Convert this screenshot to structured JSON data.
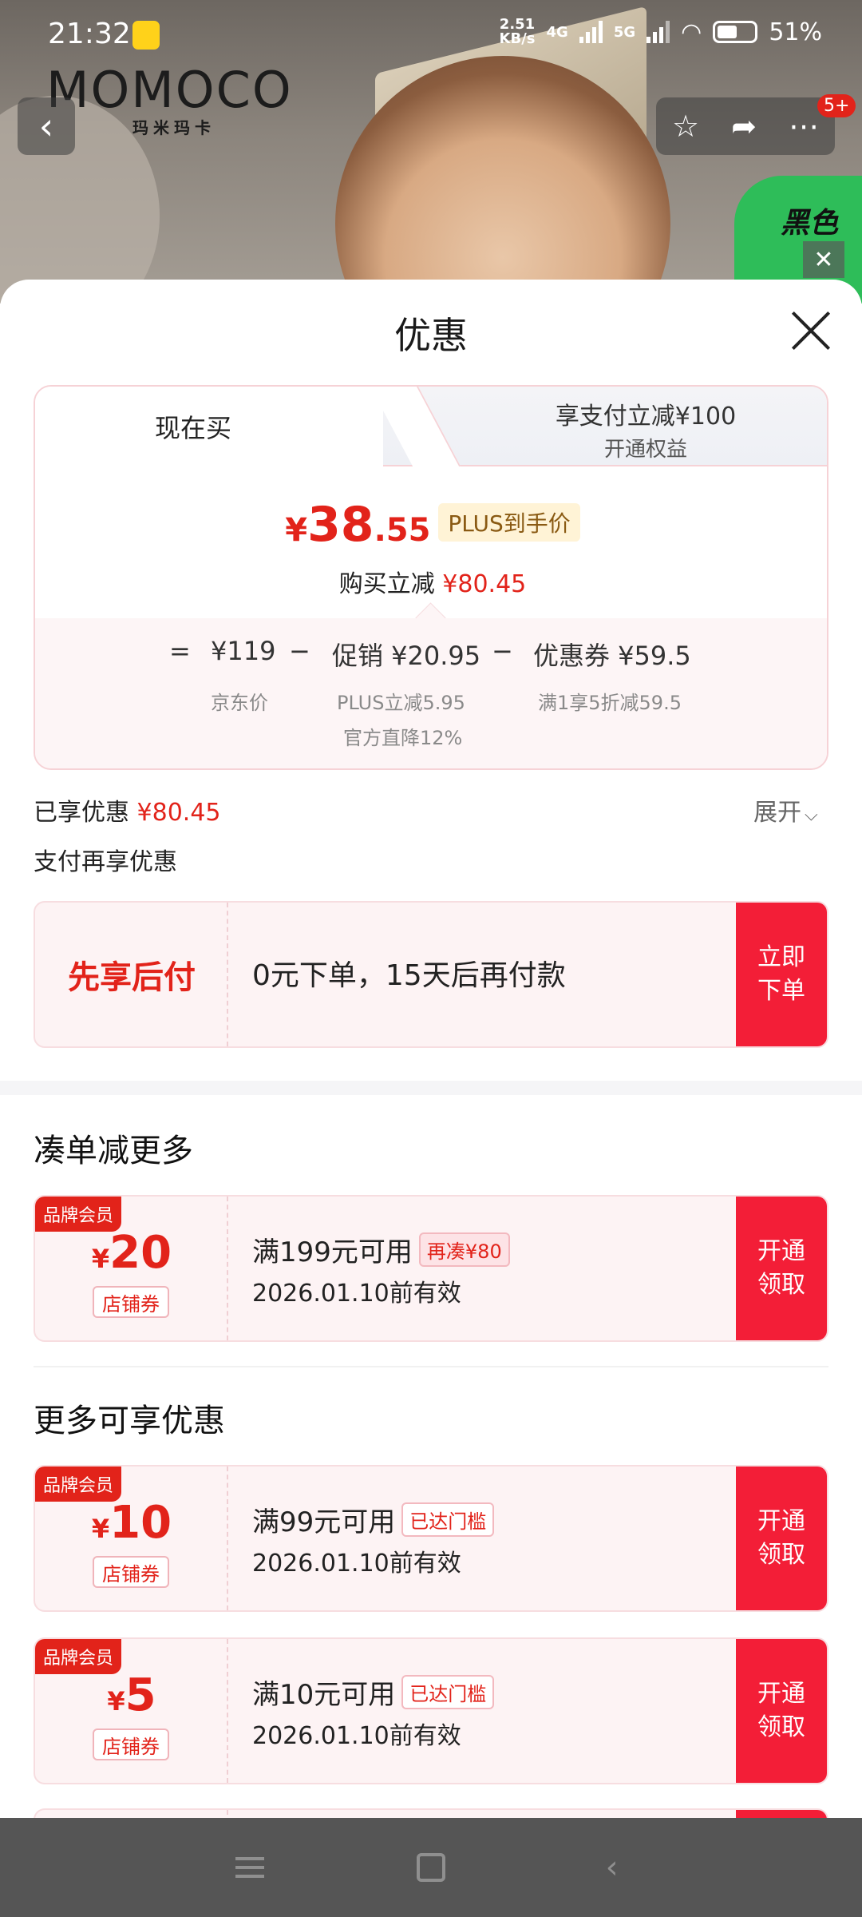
{
  "status_bar": {
    "time": "21:32",
    "speed_top": "2.51",
    "speed_bottom": "KB/s",
    "net1": "4G",
    "net2": "5G",
    "battery": "51%"
  },
  "hero": {
    "brand_logo": "MOMOCO",
    "brand_sub": "玛米玛卡",
    "green_tag": "黑色",
    "more_badge": "5+"
  },
  "sheet": {
    "title": "优惠"
  },
  "tabs": {
    "active": "现在买",
    "inactive_line1": "享支付立减¥100",
    "inactive_line2": "开通权益"
  },
  "price": {
    "currency": "¥",
    "integer": "38",
    "decimal": ".55",
    "plus_tag": "PLUS到手价",
    "save_label": "购买立减",
    "save_value": "¥80.45"
  },
  "breakdown": {
    "eq": "=",
    "minus": "−",
    "jd_price": "¥119",
    "jd_price_label": "京东价",
    "promo": "促销 ¥20.95",
    "promo_sub1": "PLUS立减5.95",
    "promo_sub2": "官方直降12%",
    "coupon": "优惠券 ¥59.5",
    "coupon_sub": "满1享5折减59.5"
  },
  "enjoyed": {
    "label": "已享优惠",
    "value": "¥80.45",
    "expand": "展开"
  },
  "pay_more": "支付再享优惠",
  "bnpl": {
    "title": "先享后付",
    "desc": "0元下单，15天后再付款",
    "action": "立即下单"
  },
  "sections": {
    "combine": "凑单减更多",
    "more": "更多可享优惠"
  },
  "coupons": [
    {
      "badge": "品牌会员",
      "currency": "¥",
      "value": "20",
      "type": "店铺券",
      "condition": "满199元可用",
      "tag": "再凑¥80",
      "valid": "2026.01.10前有效",
      "action": "开通领取"
    },
    {
      "badge": "品牌会员",
      "currency": "¥",
      "value": "10",
      "type": "店铺券",
      "condition": "满99元可用",
      "tag": "已达门槛",
      "valid": "2026.01.10前有效",
      "action": "开通领取"
    },
    {
      "badge": "品牌会员",
      "currency": "¥",
      "value": "5",
      "type": "店铺券",
      "condition": "满10元可用",
      "tag": "已达门槛",
      "valid": "2026.01.10前有效",
      "action": "开通领取"
    }
  ],
  "colors": {
    "accent": "#e2231a",
    "button": "#f31e37",
    "card_bg": "#fdf3f4"
  },
  "icons": {
    "back": "chevron-left-icon",
    "star": "star-icon",
    "share": "share-icon",
    "more": "more-dots-icon",
    "close": "close-icon",
    "expand": "chevron-down-icon"
  }
}
